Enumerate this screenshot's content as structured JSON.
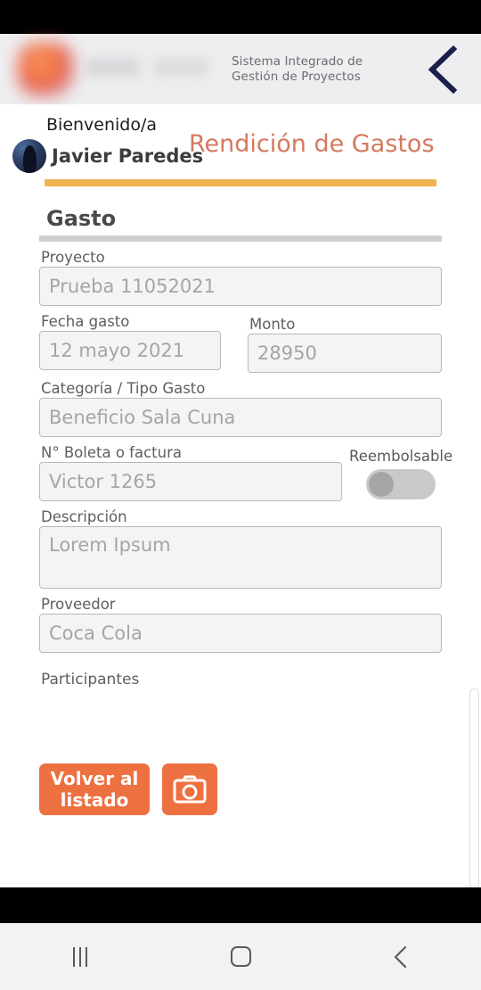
{
  "header": {
    "subtitle_line1": "Sistema Integrado de",
    "subtitle_line2": "Gestión de Proyectos",
    "back_icon": "chevron-left-icon",
    "logo": "blurred-company-logo",
    "accent_color": "#1a1f4b"
  },
  "user": {
    "welcome": "Bienvenido/a",
    "name": "Javier Paredes",
    "avatar": "user-avatar",
    "accent_bar_color": "#eeb34f"
  },
  "page_title": "Rendición de Gastos",
  "page_title_color": "#d4795f",
  "section": {
    "title": "Gasto"
  },
  "fields": {
    "proyecto": {
      "label": "Proyecto",
      "value": "Prueba 11052021"
    },
    "fecha_gasto": {
      "label": "Fecha gasto",
      "value": "12 mayo 2021"
    },
    "monto": {
      "label": "Monto",
      "value": "28950"
    },
    "categoria": {
      "label": "Categoría / Tipo Gasto",
      "value": "Beneficio Sala Cuna"
    },
    "boleta": {
      "label": "N° Boleta o factura",
      "value": "Victor 1265"
    },
    "reembolsable": {
      "label": "Reembolsable",
      "state": "off"
    },
    "descripcion": {
      "label": "Descripción",
      "value": "Lorem Ipsum"
    },
    "proveedor": {
      "label": "Proveedor",
      "value": "Coca Cola"
    },
    "participantes": {
      "label": "Participantes"
    }
  },
  "actions": {
    "back_to_list": "Volver al listado",
    "camera_icon": "camera-icon",
    "button_color": "#ed7040"
  },
  "navbar": {
    "recents_icon": "recents-icon",
    "home_icon": "home-icon",
    "back_icon": "back-icon"
  }
}
